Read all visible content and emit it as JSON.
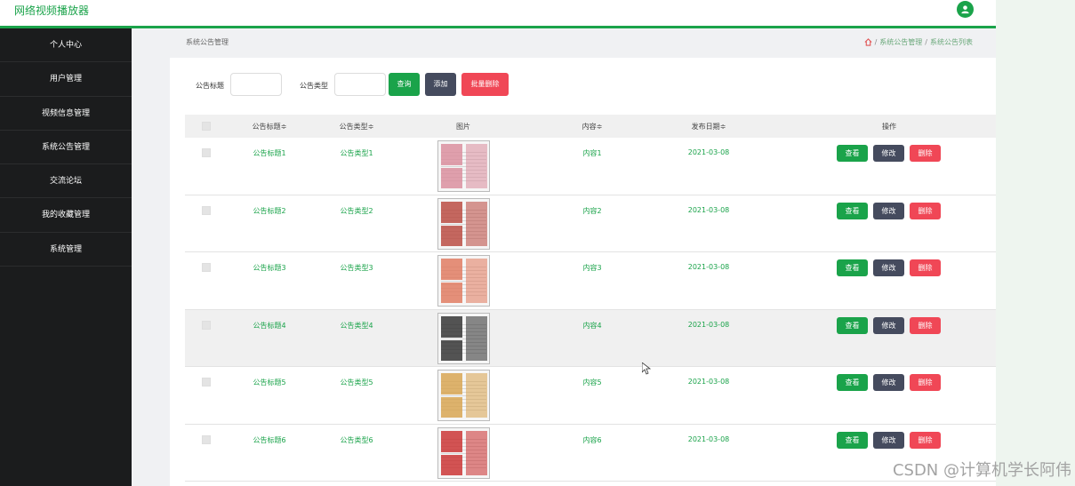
{
  "app": {
    "title": "网络视频播放器"
  },
  "sidebar": {
    "items": [
      {
        "label": "个人中心"
      },
      {
        "label": "用户管理"
      },
      {
        "label": "视频信息管理"
      },
      {
        "label": "系统公告管理"
      },
      {
        "label": "交流论坛"
      },
      {
        "label": "我的收藏管理"
      },
      {
        "label": "系统管理"
      }
    ]
  },
  "breadcrumb": {
    "page": "系统公告管理",
    "section": "系统公告管理",
    "current": "系统公告列表",
    "separator": "/"
  },
  "search": {
    "title_label": "公告标题",
    "title_value": "",
    "type_label": "公告类型",
    "type_value": "",
    "query_label": "查询",
    "add_label": "添加",
    "batch_delete_label": "批量删除"
  },
  "table": {
    "headers": [
      "公告标题≑",
      "公告类型≑",
      "图片",
      "内容≑",
      "发布日期≑",
      "操作"
    ],
    "rows": [
      {
        "title": "公告标题1",
        "type": "公告类型1",
        "content": "内容1",
        "date": "2021-03-08",
        "thumb_color": "#d98a9a"
      },
      {
        "title": "公告标题2",
        "type": "公告类型2",
        "content": "内容2",
        "date": "2021-03-08",
        "thumb_color": "#b8433a"
      },
      {
        "title": "公告标题3",
        "type": "公告类型3",
        "content": "内容3",
        "date": "2021-03-08",
        "thumb_color": "#e0765a"
      },
      {
        "title": "公告标题4",
        "type": "公告类型4",
        "content": "内容4",
        "date": "2021-03-08",
        "thumb_color": "#2a2a2a"
      },
      {
        "title": "公告标题5",
        "type": "公告类型5",
        "content": "内容5",
        "date": "2021-03-08",
        "thumb_color": "#d7a14a"
      },
      {
        "title": "公告标题6",
        "type": "公告类型6",
        "content": "内容6",
        "date": "2021-03-08",
        "thumb_color": "#c92a2a"
      }
    ],
    "view_label": "查看",
    "edit_label": "修改",
    "delete_label": "删除"
  },
  "watermark": "CSDN @计算机学长阿伟",
  "colors": {
    "accent": "#1aa34a",
    "danger": "#f04756",
    "dark_button": "#454b5e",
    "sidebar_bg": "#1b1c1d"
  }
}
